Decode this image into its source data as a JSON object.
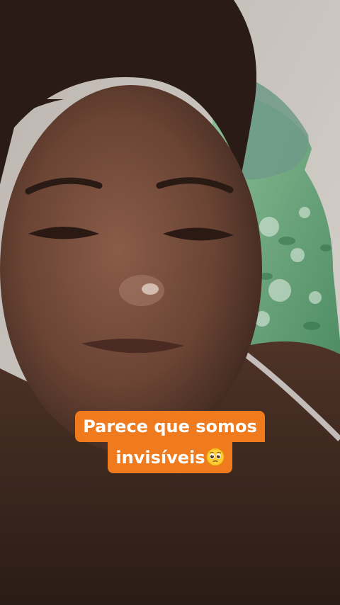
{
  "caption": {
    "line1": "Parece que somos",
    "line2": "invisíveis",
    "emoji": "pleading-face-emoji"
  },
  "colors": {
    "caption_background": "#f07a1e",
    "caption_text": "#ffffff",
    "wall": "#cfc9c4",
    "pillow": "#7fb08a",
    "skin": "#6e4635"
  }
}
